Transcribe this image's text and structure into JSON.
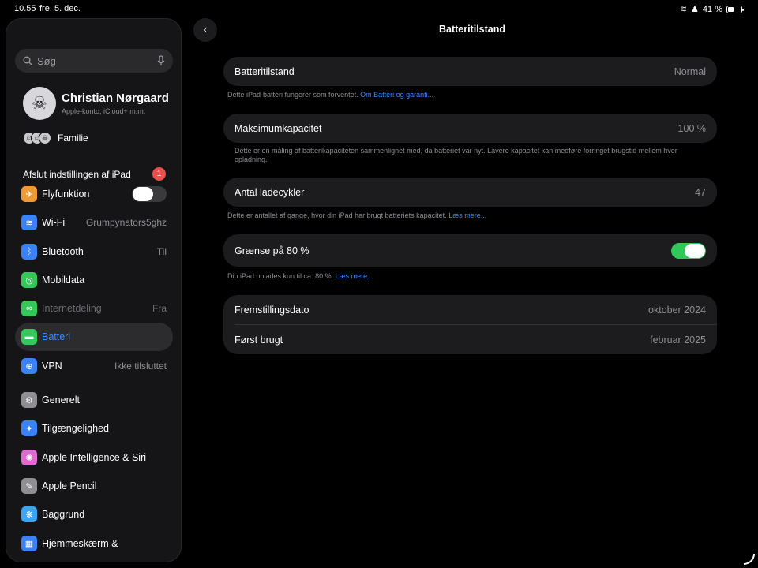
{
  "status_bar": {
    "time": "10.55",
    "date": "fre. 5. dec.",
    "battery_pct": "41 %",
    "battery_level": 0.41
  },
  "sidebar": {
    "search_placeholder": "Søg",
    "profile": {
      "name": "Christian Nørgaard",
      "subtitle": "Apple-konto, iCloud+ m.m."
    },
    "family_label": "Familie",
    "setup": {
      "label": "Afslut indstillingen af iPad",
      "badge": "1"
    },
    "items": [
      {
        "label": "Flyfunktion",
        "value": "",
        "toggle": "off",
        "icon": "airplane-icon",
        "color": "#f09a37",
        "glyph": "✈"
      },
      {
        "label": "Wi-Fi",
        "value": "Grumpynators5ghz",
        "icon": "wifi-icon",
        "color": "#3b82f6",
        "glyph": "≋"
      },
      {
        "label": "Bluetooth",
        "value": "Til",
        "icon": "bluetooth-icon",
        "color": "#3b82f6",
        "glyph": "ᛒ"
      },
      {
        "label": "Mobildata",
        "value": "",
        "icon": "antenna-icon",
        "color": "#34c759",
        "glyph": "◎"
      },
      {
        "label": "Internetdeling",
        "value": "Fra",
        "icon": "hotspot-icon",
        "color": "#34c759",
        "glyph": "∞",
        "dim": true
      },
      {
        "label": "Batteri",
        "value": "",
        "icon": "battery-icon",
        "color": "#34c759",
        "glyph": "▬",
        "active": true
      },
      {
        "label": "VPN",
        "value": "Ikke tilsluttet",
        "icon": "vpn-icon",
        "color": "#3b82f6",
        "glyph": "⊕"
      },
      {
        "label": "Generelt",
        "value": "",
        "icon": "gear-icon",
        "color": "#8e8e93",
        "glyph": "⚙"
      },
      {
        "label": "Tilgængelighed",
        "value": "",
        "icon": "accessibility-icon",
        "color": "#3b82f6",
        "glyph": "✦"
      },
      {
        "label": "Apple Intelligence & Siri",
        "value": "",
        "icon": "siri-icon",
        "color": "#e06bd0",
        "glyph": "✺"
      },
      {
        "label": "Apple Pencil",
        "value": "",
        "icon": "pencil-icon",
        "color": "#8e8e93",
        "glyph": "✎"
      },
      {
        "label": "Baggrund",
        "value": "",
        "icon": "wallpaper-icon",
        "color": "#3ba5f6",
        "glyph": "❋"
      },
      {
        "label": "Hjemmeskærm &",
        "value": "",
        "icon": "homescreen-icon",
        "color": "#3b82f6",
        "glyph": "▦"
      }
    ]
  },
  "main": {
    "title": "Batteritilstand",
    "health": {
      "label": "Batteritilstand",
      "value": "Normal",
      "footer": "Dette iPad-batteri fungerer som forventet.",
      "footer_link": "Om Batteri og garanti..."
    },
    "capacity": {
      "label": "Maksimumkapacitet",
      "value": "100 %",
      "footer": "Dette er en måling af batterikapaciteten sammenlignet med, da batteriet var nyt. Lavere kapacitet kan medføre forringet brugstid mellem hver opladning."
    },
    "cycles": {
      "label": "Antal ladecykler",
      "value": "47",
      "footer": "Dette er antallet af gange, hvor din iPad har brugt batteriets kapacitet.",
      "footer_link": "Læs mere..."
    },
    "limit": {
      "label": "Grænse på 80 %",
      "toggle": "on",
      "footer": "Din iPad oplades kun til ca. 80 %.",
      "footer_link": "Læs mere..."
    },
    "dates": [
      {
        "label": "Fremstillingsdato",
        "value": "oktober 2024"
      },
      {
        "label": "Først brugt",
        "value": "februar 2025"
      }
    ]
  }
}
